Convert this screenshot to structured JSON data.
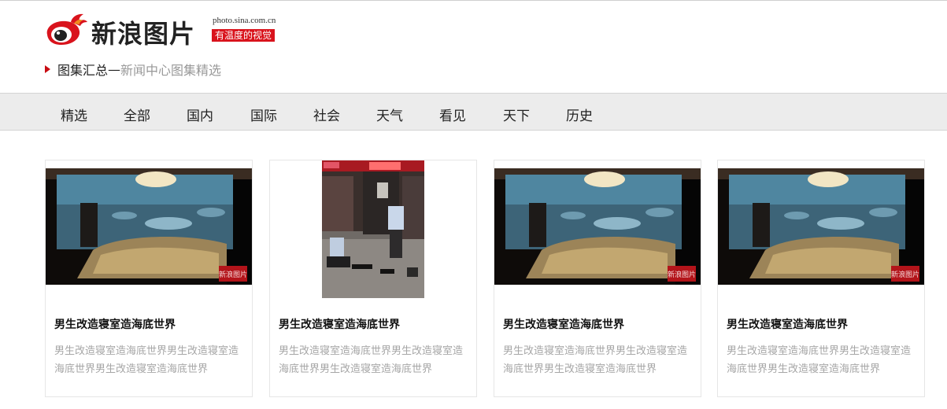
{
  "header": {
    "logo_text": "新浪图片",
    "domain": "photo.sina.com.cn",
    "slogan": "有温度的视觉"
  },
  "breadcrumb": {
    "main": "图集汇总",
    "separator": "—",
    "sub": "新闻中心图集精选"
  },
  "nav": {
    "items": [
      "精选",
      "全部",
      "国内",
      "国际",
      "社会",
      "天气",
      "看见",
      "天下",
      "历史"
    ]
  },
  "cards": [
    {
      "image": "bedroom-ocean-mural",
      "watermark": "新浪图片",
      "title": "男生改造寝室造海底世界",
      "desc": "男生改造寝室造海底世界男生改造寝室造海底世界男生改造寝室造海底世界"
    },
    {
      "image": "street-police-scene",
      "title": "男生改造寝室造海底世界",
      "desc": "男生改造寝室造海底世界男生改造寝室造海底世界男生改造寝室造海底世界"
    },
    {
      "image": "bedroom-ocean-mural",
      "watermark": "新浪图片",
      "title": "男生改造寝室造海底世界",
      "desc": "男生改造寝室造海底世界男生改造寝室造海底世界男生改造寝室造海底世界"
    },
    {
      "image": "bedroom-ocean-mural",
      "watermark": "新浪图片",
      "title": "男生改造寝室造海底世界",
      "desc": "男生改造寝室造海底世界男生改造寝室造海底世界男生改造寝室造海底世界"
    }
  ],
  "colors": {
    "brand_red": "#d9131c",
    "nav_bg": "#ececec",
    "muted_text": "#a6a6a6"
  }
}
